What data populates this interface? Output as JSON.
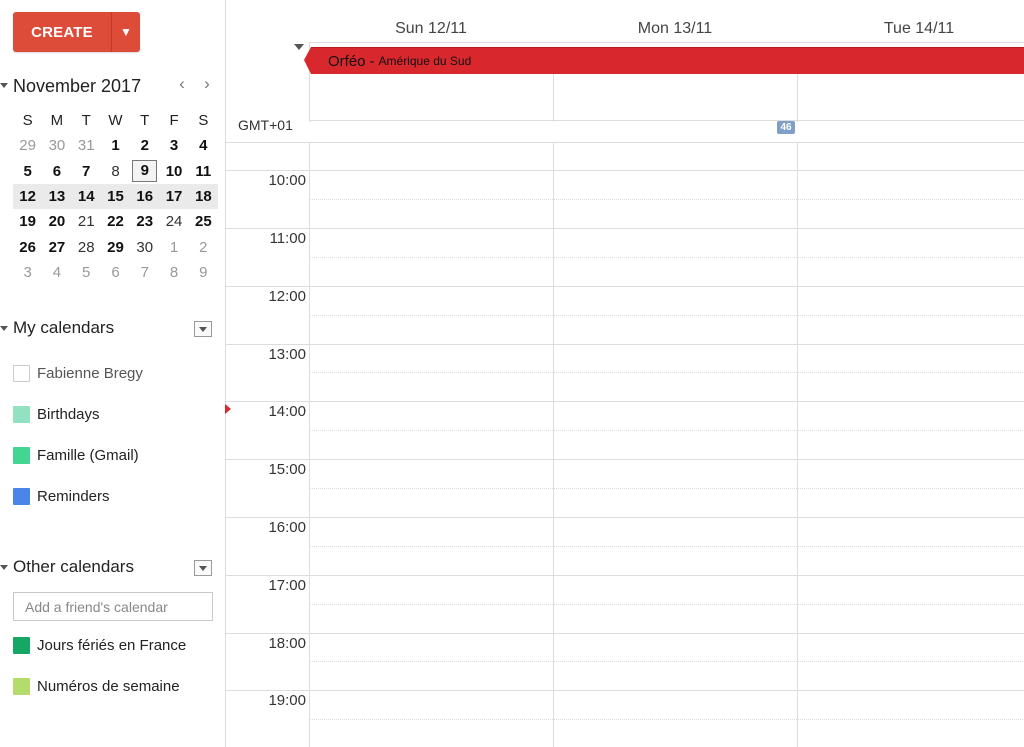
{
  "toolbar": {
    "create_label": "CREATE",
    "create_menu_icon": "caret-down-icon"
  },
  "mini_calendar": {
    "title": "November 2017",
    "prev_icon": "‹",
    "next_icon": "›",
    "weekdays": [
      "S",
      "M",
      "T",
      "W",
      "T",
      "F",
      "S"
    ],
    "weeks": [
      [
        "29",
        "30",
        "31",
        "1",
        "2",
        "3",
        "4"
      ],
      [
        "5",
        "6",
        "7",
        "8",
        "9",
        "10",
        "11"
      ],
      [
        "12",
        "13",
        "14",
        "15",
        "16",
        "17",
        "18"
      ],
      [
        "19",
        "20",
        "21",
        "22",
        "23",
        "24",
        "25"
      ],
      [
        "26",
        "27",
        "28",
        "29",
        "30",
        "1",
        "2"
      ],
      [
        "3",
        "4",
        "5",
        "6",
        "7",
        "8",
        "9"
      ]
    ],
    "today": "9"
  },
  "my_calendars": {
    "title": "My calendars",
    "items": [
      {
        "label": "Fabienne Bregy",
        "color": "#ffffff"
      },
      {
        "label": "Birthdays",
        "color": "#92e1c0"
      },
      {
        "label": "Famille (Gmail)",
        "color": "#42d692"
      },
      {
        "label": "Reminders",
        "color": "#4a86e8"
      }
    ]
  },
  "other_calendars": {
    "title": "Other calendars",
    "add_placeholder": "Add a friend's calendar",
    "items": [
      {
        "label": "Jours fériés en France",
        "color": "#16a765"
      },
      {
        "label": "Numéros de semaine",
        "color": "#b3dc6c"
      }
    ]
  },
  "week_view": {
    "days": [
      "Sun 12/11",
      "Mon 13/11",
      "Tue 14/11"
    ],
    "timezone": "GMT+01",
    "week_number": "46",
    "hours": [
      "10:00",
      "11:00",
      "12:00",
      "13:00",
      "14:00",
      "15:00",
      "16:00",
      "17:00",
      "18:00",
      "19:00"
    ],
    "event": {
      "title": "Orféo",
      "separator": "-",
      "subtitle": "Amérique du Sud",
      "color": "#d9272e"
    }
  }
}
